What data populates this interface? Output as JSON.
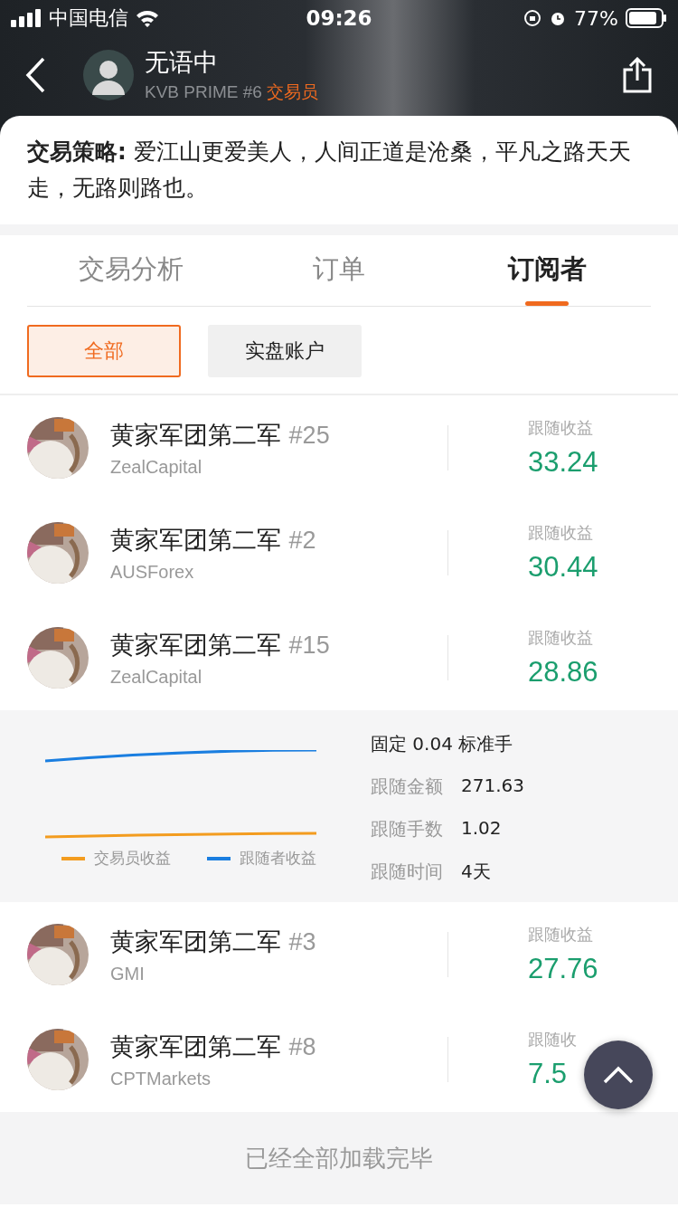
{
  "status_bar": {
    "carrier": "中国电信",
    "time": "09:26",
    "battery": "77%"
  },
  "header": {
    "name": "无语中",
    "subtitle": "KVB PRIME #6",
    "role": "交易员"
  },
  "strategy": {
    "label": "交易策略:",
    "text": "爱江山更爱美人，人间正道是沧桑，平凡之路天天走，无路则路也。"
  },
  "tabs": [
    {
      "label": "交易分析",
      "selected": false
    },
    {
      "label": "订单",
      "selected": false
    },
    {
      "label": "订阅者",
      "selected": true
    }
  ],
  "filters": [
    {
      "label": "全部",
      "selected": true
    },
    {
      "label": "实盘账户",
      "selected": false
    }
  ],
  "subscribers": [
    {
      "name": "黄家军团第二军",
      "rank": "#25",
      "broker": "ZealCapital",
      "profit_label": "跟随收益",
      "profit": "33.24"
    },
    {
      "name": "黄家军团第二军",
      "rank": "#2",
      "broker": "AUSForex",
      "profit_label": "跟随收益",
      "profit": "30.44"
    },
    {
      "name": "黄家军团第二军",
      "rank": "#15",
      "broker": "ZealCapital",
      "profit_label": "跟随收益",
      "profit": "28.86",
      "detail": {
        "legend": [
          {
            "label": "交易员收益",
            "color": "#f39c1f"
          },
          {
            "label": "跟随者收益",
            "color": "#1a7ee0"
          }
        ],
        "mode": "固定 0.04 标准手",
        "stats": [
          {
            "label": "跟随金额",
            "value": "271.63"
          },
          {
            "label": "跟随手数",
            "value": "1.02"
          },
          {
            "label": "跟随时间",
            "value": "4天"
          }
        ]
      }
    },
    {
      "name": "黄家军团第二军",
      "rank": "#3",
      "broker": "GMI",
      "profit_label": "跟随收益",
      "profit": "27.76"
    },
    {
      "name": "黄家军团第二军",
      "rank": "#8",
      "broker": "CPTMarkets",
      "profit_label": "跟随收",
      "profit": "7.5"
    }
  ],
  "footer": "已经全部加载完毕"
}
